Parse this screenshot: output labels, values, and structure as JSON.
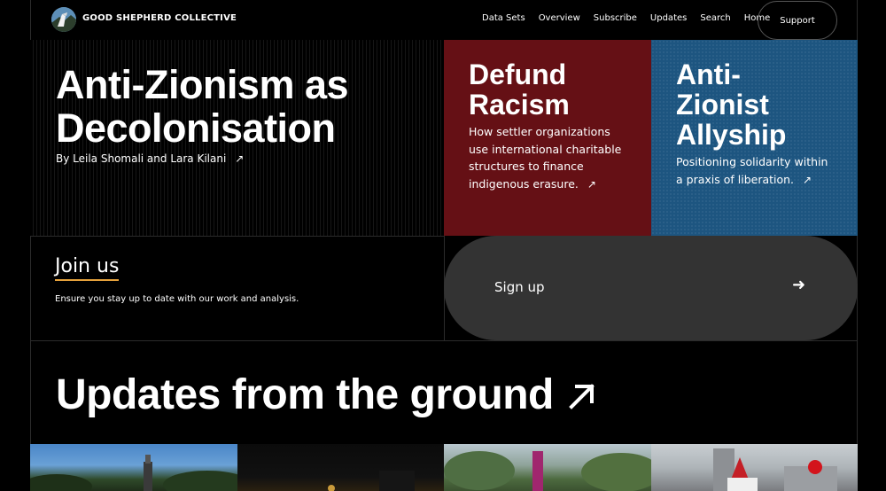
{
  "header": {
    "brand": "GOOD SHEPHERD COLLECTIVE",
    "nav": [
      "Data Sets",
      "Overview",
      "Subscribe",
      "Updates",
      "Search",
      "Home"
    ],
    "support_label": "Support"
  },
  "hero": {
    "title": "Anti-Zionism as Decolonisation",
    "byline": "By Leila Shomali and Lara Kilani",
    "arrow": "↗"
  },
  "cards": [
    {
      "title": "Defund Racism",
      "text": "How settler organizations use international charitable structures to finance indigenous erasure.",
      "arrow": "↗",
      "color": "#651015"
    },
    {
      "title": "Anti-Zionist Allyship",
      "text": "Positioning solidarity within a praxis of liberation.",
      "arrow": "↗",
      "color": "#1d5580"
    }
  ],
  "join": {
    "title": "Join us",
    "text": "Ensure you stay up to date with our work and analysis.",
    "underline_color": "#e6a23c"
  },
  "signup": {
    "label": "Sign up",
    "arrow": "➜"
  },
  "updates": {
    "title": "Updates from the ground"
  },
  "icons": {
    "logo": "shepherd-logo-icon",
    "updates_arrow": "arrow-up-right-icon"
  }
}
